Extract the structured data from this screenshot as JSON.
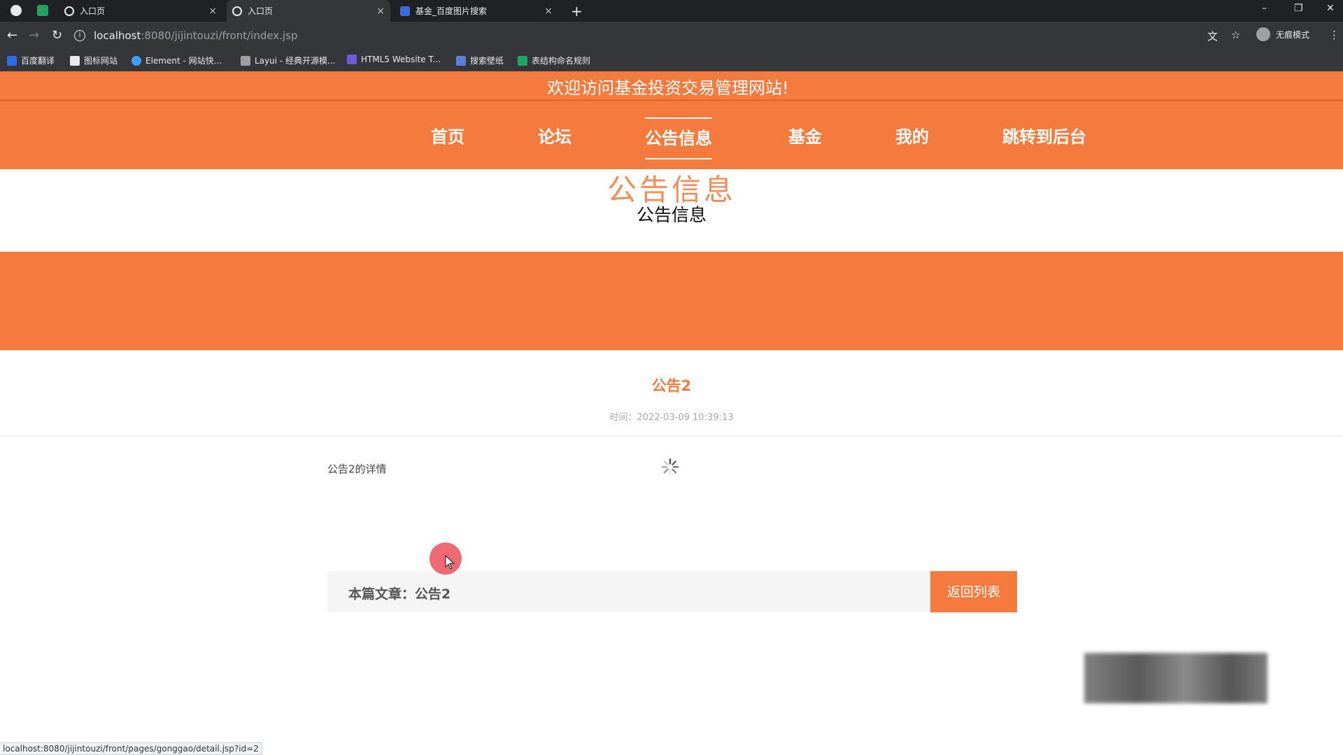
{
  "browser": {
    "tabs": [
      {
        "title": "入口页",
        "active": false
      },
      {
        "title": "入口页",
        "active": true
      },
      {
        "title": "基金_百度图片搜索",
        "active": false
      }
    ],
    "new_tab_symbol": "+",
    "tab_close_symbol": "×",
    "url_host": "localhost",
    "url_rest": ":8080/jijintouzi/front/index.jsp",
    "profile_label": "无痕模式",
    "bookmarks": [
      {
        "label": "百度翻译",
        "icon": "translate-icon"
      },
      {
        "label": "图标网站",
        "icon": "flag-icon"
      },
      {
        "label": "Element - 网站快...",
        "icon": "element-icon"
      },
      {
        "label": "Layui - 经典开源模...",
        "icon": "layui-icon"
      },
      {
        "label": "HTML5 Website T...",
        "icon": "html5-icon"
      },
      {
        "label": "搜索壁纸",
        "icon": "wallpaper-icon"
      },
      {
        "label": "表结构命名规则",
        "icon": "sheet-icon"
      }
    ],
    "status_url": "localhost:8080/jijintouzi/front/pages/gonggao/detail.jsp?id=2"
  },
  "site": {
    "welcome": "欢迎访问基金投资交易管理网站!",
    "nav": [
      {
        "label": "首页",
        "active": false
      },
      {
        "label": "论坛",
        "active": false
      },
      {
        "label": "公告信息",
        "active": true
      },
      {
        "label": "基金",
        "active": false
      },
      {
        "label": "我的",
        "active": false
      },
      {
        "label": "跳转到后台",
        "active": false
      }
    ]
  },
  "section": {
    "title_large": "公告信息",
    "title": "公告信息"
  },
  "article": {
    "title": "公告2",
    "time": "时间：2022-03-09 10:39:13",
    "body": "公告2的详情",
    "footer_label": "本篇文章：公告2",
    "back_button": "返回列表"
  },
  "colors": {
    "accent": "#f47a3d",
    "browser_dark": "#202124"
  }
}
